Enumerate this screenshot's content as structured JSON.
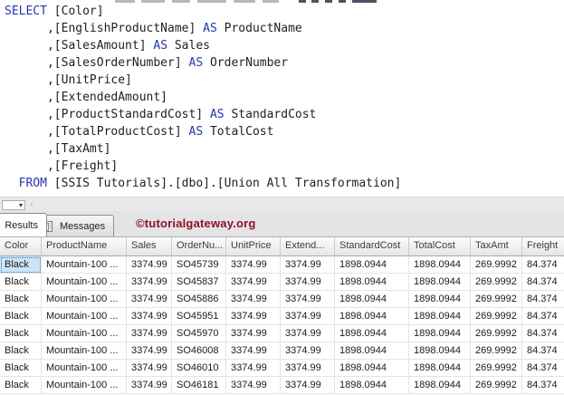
{
  "editor": {
    "lines": [
      {
        "segments": [
          {
            "text": "SELECT",
            "kw": true
          },
          {
            "text": " [Color]"
          }
        ]
      },
      {
        "segments": [
          {
            "text": "      ,[EnglishProductName] "
          },
          {
            "text": "AS",
            "kw": true
          },
          {
            "text": " ProductName"
          }
        ]
      },
      {
        "segments": [
          {
            "text": "      ,[SalesAmount] "
          },
          {
            "text": "AS",
            "kw": true
          },
          {
            "text": " Sales"
          }
        ]
      },
      {
        "segments": [
          {
            "text": "      ,[SalesOrderNumber] "
          },
          {
            "text": "AS",
            "kw": true
          },
          {
            "text": " OrderNumber"
          }
        ]
      },
      {
        "segments": [
          {
            "text": "      ,[UnitPrice]"
          }
        ]
      },
      {
        "segments": [
          {
            "text": "      ,[ExtendedAmount]"
          }
        ]
      },
      {
        "segments": [
          {
            "text": "      ,[ProductStandardCost] "
          },
          {
            "text": "AS",
            "kw": true
          },
          {
            "text": " StandardCost"
          }
        ]
      },
      {
        "segments": [
          {
            "text": "      ,[TotalProductCost] "
          },
          {
            "text": "AS",
            "kw": true
          },
          {
            "text": " TotalCost"
          }
        ]
      },
      {
        "segments": [
          {
            "text": "      ,[TaxAmt]"
          }
        ]
      },
      {
        "segments": [
          {
            "text": "      ,[Freight]"
          }
        ]
      },
      {
        "segments": [
          {
            "text": "  "
          },
          {
            "text": "FROM",
            "kw": true
          },
          {
            "text": " [SSIS Tutorials].[dbo].[Union All Transformation]"
          }
        ]
      }
    ],
    "keyword_color": "#2233c4",
    "text_color": "#1f1f1f"
  },
  "splitter": {
    "dropdown_icon": "▾",
    "chevron_icon": "‹"
  },
  "tabs": {
    "results_label": "Results",
    "messages_label": "Messages",
    "messages_icon": "message-document-icon"
  },
  "watermark": {
    "text": "©tutorialgateway.org",
    "color": "#8e1126"
  },
  "grid": {
    "columns": [
      "Color",
      "ProductName",
      "Sales",
      "OrderNu...",
      "UnitPrice",
      "Extend...",
      "StandardCost",
      "TotalCost",
      "TaxAmt",
      "Freight"
    ],
    "rows": [
      [
        "Black",
        "Mountain-100 ...",
        "3374.99",
        "SO45739",
        "3374.99",
        "3374.99",
        "1898.0944",
        "1898.0944",
        "269.9992",
        "84.374"
      ],
      [
        "Black",
        "Mountain-100 ...",
        "3374.99",
        "SO45837",
        "3374.99",
        "3374.99",
        "1898.0944",
        "1898.0944",
        "269.9992",
        "84.374"
      ],
      [
        "Black",
        "Mountain-100 ...",
        "3374.99",
        "SO45886",
        "3374.99",
        "3374.99",
        "1898.0944",
        "1898.0944",
        "269.9992",
        "84.374"
      ],
      [
        "Black",
        "Mountain-100 ...",
        "3374.99",
        "SO45951",
        "3374.99",
        "3374.99",
        "1898.0944",
        "1898.0944",
        "269.9992",
        "84.374"
      ],
      [
        "Black",
        "Mountain-100 ...",
        "3374.99",
        "SO45970",
        "3374.99",
        "3374.99",
        "1898.0944",
        "1898.0944",
        "269.9992",
        "84.374"
      ],
      [
        "Black",
        "Mountain-100 ...",
        "3374.99",
        "SO46008",
        "3374.99",
        "3374.99",
        "1898.0944",
        "1898.0944",
        "269.9992",
        "84.374"
      ],
      [
        "Black",
        "Mountain-100 ...",
        "3374.99",
        "SO46010",
        "3374.99",
        "3374.99",
        "1898.0944",
        "1898.0944",
        "269.9992",
        "84.374"
      ],
      [
        "Black",
        "Mountain-100 ...",
        "3374.99",
        "SO46181",
        "3374.99",
        "3374.99",
        "1898.0944",
        "1898.0944",
        "269.9992",
        "84.374"
      ]
    ],
    "selected_cell": {
      "row": 0,
      "col": 0
    },
    "selected_bg": "#cbe4f7"
  }
}
